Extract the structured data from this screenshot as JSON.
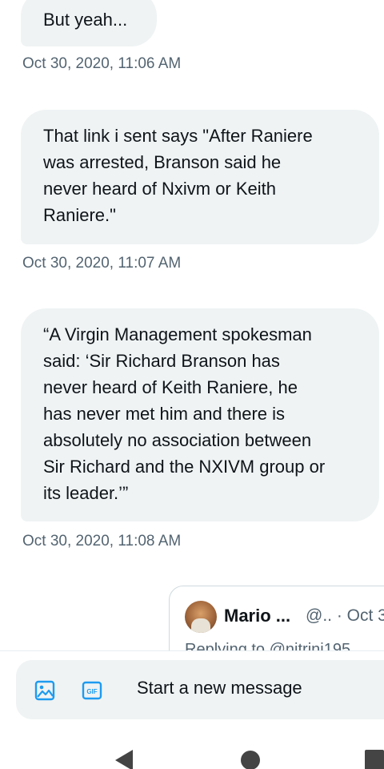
{
  "messages": [
    {
      "text": "But yeah...",
      "timestamp": "Oct 30, 2020, 11:06 AM"
    },
    {
      "text": "That link i sent says \"After Raniere\nwas arrested, Branson said he\nnever heard of Nxivm or Keith\nRaniere.\"",
      "timestamp": "Oct 30, 2020, 11:07 AM"
    },
    {
      "text": "“A Virgin Management spokesman\nsaid: ‘Sir Richard Branson has\nnever heard of Keith Raniere, he\nhas never met him and there is\nabsolutely no association between\nSir Richard and the NXIVM group or\nits leader.’”",
      "timestamp": "Oct 30, 2020, 11:08 AM"
    }
  ],
  "quoted_tweet": {
    "name": "Mario ...",
    "handle_meta": "@.. · Oct 3",
    "replying": "Replying to @nitrini195"
  },
  "composer": {
    "placeholder": "Start a new message",
    "icons": [
      "image-icon",
      "gif-icon"
    ],
    "accent": "#1d9bf0"
  },
  "nav": {
    "icons": [
      "back-icon",
      "home-icon",
      "recents-icon"
    ]
  }
}
